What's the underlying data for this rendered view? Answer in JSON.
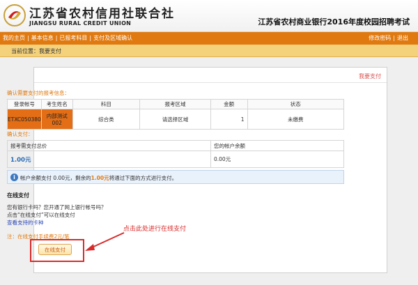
{
  "header": {
    "logo_cn": "江苏省农村信用社联合社",
    "logo_en": "JIANGSU RURAL CREDIT UNION",
    "title": "江苏省农村商业银行2016年度校园招聘考试",
    "logo_icon": "bank-emblem-icon"
  },
  "nav": {
    "items": [
      {
        "label": "我的主页"
      },
      {
        "label": "基本信息"
      },
      {
        "label": "已报考科目"
      },
      {
        "label": "支付及区域确认"
      }
    ],
    "separator": "|",
    "right": [
      {
        "label": "修改密码"
      },
      {
        "label": "退出"
      }
    ]
  },
  "breadcrumb": "当前位置：我要支付",
  "content": {
    "title": "我要支付",
    "confirm_label": "确认需要支付的报考信息：",
    "table1": {
      "headers": [
        "登录帐号",
        "考生姓名",
        "科目",
        "报考区域",
        "金额",
        "状态"
      ],
      "row": [
        "ETXC050380",
        "内部测试002",
        "综合类",
        "请选择区域",
        "1",
        "未缴费"
      ]
    },
    "pay_label": "确认支付：",
    "table2": {
      "headers": [
        "报考需支付总价",
        "您的帐户余额"
      ],
      "row": [
        "1.00元",
        "0.00元"
      ]
    },
    "notice": {
      "icon": "info-icon",
      "before": "帐户余额支付 0.00元，剩余的",
      "amount": "1.00元",
      "after": "将通过下面的方式进行支付。"
    },
    "online": {
      "title": "在线支付",
      "line1": "您有银行卡吗？您开通了网上银行帐号吗？",
      "line2": "点击“在线支付”可以在线支付",
      "link": "查看支持的卡种"
    },
    "fee_note": "注：在线支付手续费2元/笔",
    "pay_button": "在线支付",
    "callout": "点击此处进行在线支付"
  },
  "colors": {
    "nav_bg": "#e07a10",
    "crumb_bg": "#f4d27c",
    "highlight": "#d92a2a",
    "link": "#2a46b5"
  }
}
